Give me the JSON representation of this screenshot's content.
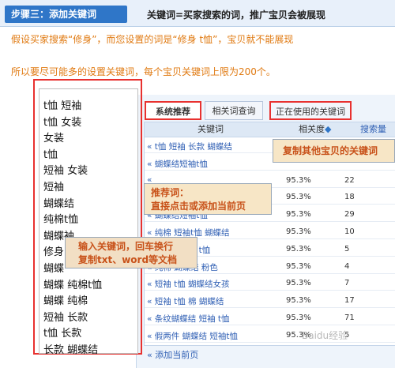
{
  "header": {
    "step": "步骤三：添加关键词",
    "desc": "关键词=买家搜索的词，推广宝贝会被展现"
  },
  "intro": {
    "line1": "假设买家搜索“修身”，而您设置的词是“修身 t恤”，宝贝就不能展现",
    "line2": "所以要尽可能多的设置关键词，每个宝贝关键词上限为200个。"
  },
  "keywords_input": [
    "t恤 短袖",
    "t恤 女装",
    "女装",
    "t恤",
    "短袖 女装",
    "短袖",
    "蝴蝶结",
    "纯棉t恤",
    "蝴蝶袖",
    "修身",
    "蝴蝶",
    "蝴蝶 纯棉t恤",
    "蝴蝶 纯棉",
    "短袖 长款",
    "t恤 长款",
    "长款 蝴蝶结"
  ],
  "tabs": [
    "系统推荐",
    "相关词查询",
    "正在使用的关键词"
  ],
  "table": {
    "headers": {
      "keyword": "关键词",
      "relevance": "相关度",
      "search": "搜索量"
    },
    "rows": [
      {
        "kw": "« t恤 短袖 长款 蝴蝶结",
        "rel": "",
        "cnt": ""
      },
      {
        "kw": "« 蝴蝶结短袖t恤",
        "rel": "",
        "cnt": ""
      },
      {
        "kw": "«",
        "rel": "95.3%",
        "cnt": "22"
      },
      {
        "kw": "«",
        "rel": "95.3%",
        "cnt": "18"
      },
      {
        "kw": "« 蝴蝶结短袖t恤",
        "rel": "95.3%",
        "cnt": "29"
      },
      {
        "kw": "« 纯棉 短袖t恤 蝴蝶结",
        "rel": "95.3%",
        "cnt": "10"
      },
      {
        "kw": "« 蝴蝶结短袖 t恤",
        "rel": "95.3%",
        "cnt": "5"
      },
      {
        "kw": "« 纯棉 蝴蝶结 粉色",
        "rel": "95.3%",
        "cnt": "4"
      },
      {
        "kw": "« 短袖 t恤 蝴蝶结女孩",
        "rel": "95.3%",
        "cnt": "7"
      },
      {
        "kw": "« 短袖 t恤 棉 蝴蝶结",
        "rel": "95.3%",
        "cnt": "17"
      },
      {
        "kw": "« 条纹蝴蝶结 短袖 t恤",
        "rel": "95.3%",
        "cnt": "71"
      },
      {
        "kw": "« 假两件 蝴蝶结 短袖t恤",
        "rel": "95.3%",
        "cnt": "5"
      }
    ],
    "add_current": "« 添加当前页"
  },
  "notes": {
    "copy_other": "复制其他宝贝的关键词",
    "recommend_title": "推荐词：",
    "recommend_body": "直接点击或添加当前页",
    "input_title": "输入关键词，回车换行",
    "input_body": "复制txt、word等文档"
  },
  "watermark": "Baidu经验"
}
